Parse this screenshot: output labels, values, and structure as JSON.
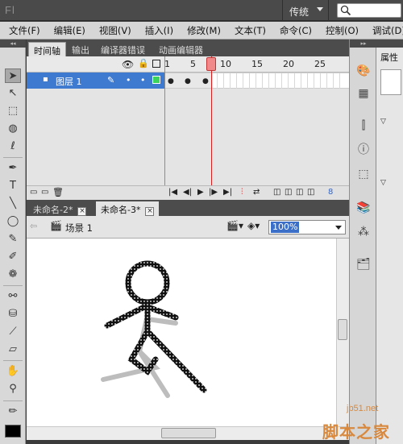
{
  "app": {
    "logo": "Fl",
    "workspace": "传统"
  },
  "menu": [
    "文件(F)",
    "编辑(E)",
    "视图(V)",
    "插入(I)",
    "修改(M)",
    "文本(T)",
    "命令(C)",
    "控制(O)",
    "调试(D)"
  ],
  "panel_tabs": [
    "时间轴",
    "输出",
    "编译器错误",
    "动画编辑器"
  ],
  "timeline": {
    "frame_numbers": [
      "1",
      "5",
      "10",
      "15",
      "20",
      "25"
    ],
    "layer_name": "图层 1",
    "current_frame": 8
  },
  "doc_tabs": [
    "未命名-2*",
    "未命名-3*"
  ],
  "scene": {
    "label": "场景 1",
    "zoom": "100%"
  },
  "properties": {
    "tab": "属性"
  },
  "watermark": {
    "url": "jb51.net",
    "text": "脚本之家"
  },
  "colors": {
    "accent": "#3e7bd0",
    "playhead": "#d92020",
    "watermark": "#d8893e"
  }
}
